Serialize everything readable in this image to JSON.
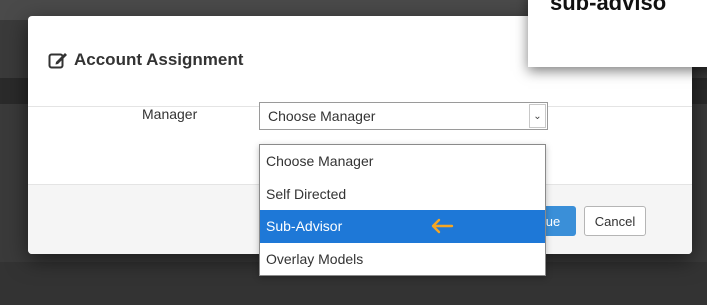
{
  "modal": {
    "title": "Account Assignment",
    "title_icon": "edit-icon"
  },
  "form": {
    "manager_label": "Manager",
    "manager_select": {
      "value": "Choose Manager",
      "options": [
        "Choose Manager",
        "Self Directed",
        "Sub-Advisor",
        "Overlay Models"
      ],
      "highlighted": "Sub-Advisor"
    }
  },
  "footer": {
    "primary_label_visible": "ue",
    "cancel_label": "Cancel"
  },
  "callout": {
    "text": "sub-adviso"
  },
  "colors": {
    "highlight": "#1e78d7",
    "arrow": "#f5a623",
    "primary_button": "#3a8fd8"
  }
}
